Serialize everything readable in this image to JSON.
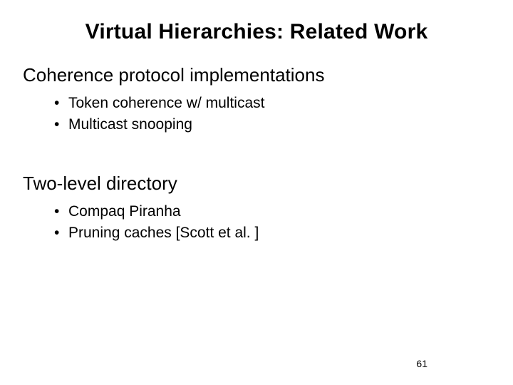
{
  "title": "Virtual Hierarchies:  Related Work",
  "sections": [
    {
      "heading": "Coherence protocol implementations",
      "items": [
        "Token coherence w/ multicast",
        "Multicast  snooping"
      ]
    },
    {
      "heading": "Two-level directory",
      "items": [
        "Compaq Piranha",
        "Pruning caches [Scott et al. ]"
      ]
    }
  ],
  "page_number": "61"
}
